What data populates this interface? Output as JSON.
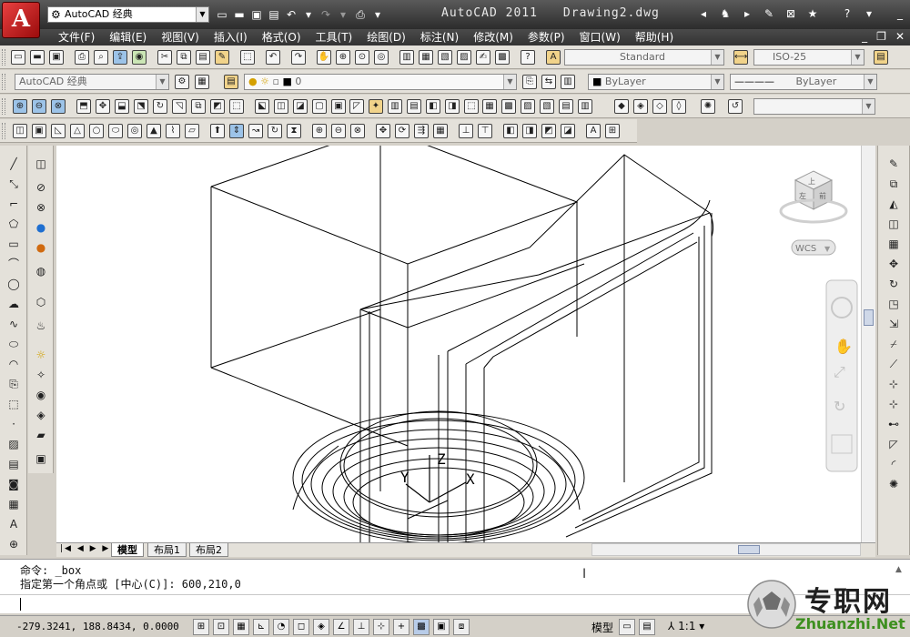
{
  "app": {
    "title": "AutoCAD 2011",
    "document": "Drawing2.dwg",
    "logo_letter": "A",
    "workspace": "AutoCAD 经典"
  },
  "menu": [
    "文件(F)",
    "编辑(E)",
    "视图(V)",
    "插入(I)",
    "格式(O)",
    "工具(T)",
    "绘图(D)",
    "标注(N)",
    "修改(M)",
    "参数(P)",
    "窗口(W)",
    "帮助(H)"
  ],
  "styles_toolbar": {
    "text_style": "Standard",
    "dim_style": "ISO-25"
  },
  "layers_toolbar": {
    "workspace_combo": "AutoCAD 经典",
    "layer_name": "0",
    "color": "ByLayer",
    "linetype": "ByLayer"
  },
  "viewcube": {
    "top_face": "上",
    "left_face": "左",
    "right_face": "前",
    "wcs_label": "WCS"
  },
  "ucs_icon": {
    "x": "X",
    "y": "Y",
    "z": "Z"
  },
  "layout_tabs": [
    "模型",
    "布局1",
    "布局2"
  ],
  "command": {
    "history": [
      "命令: _box",
      "指定第一个角点或 [中心(C)]: 600,210,0"
    ],
    "prompt": ""
  },
  "status": {
    "coordinates": "-279.3241, 188.8434, 0.0000",
    "model_label": "模型",
    "annotation_scale": "1:1"
  },
  "watermark": {
    "text": "专职网",
    "url": "Zhuanzhi.Net"
  },
  "colors": {
    "titlebar": "#3c3c3c",
    "toolbar_bg": "#e4e1da",
    "viewport_bg": "#ffffff",
    "logo_red": "#c01818"
  }
}
